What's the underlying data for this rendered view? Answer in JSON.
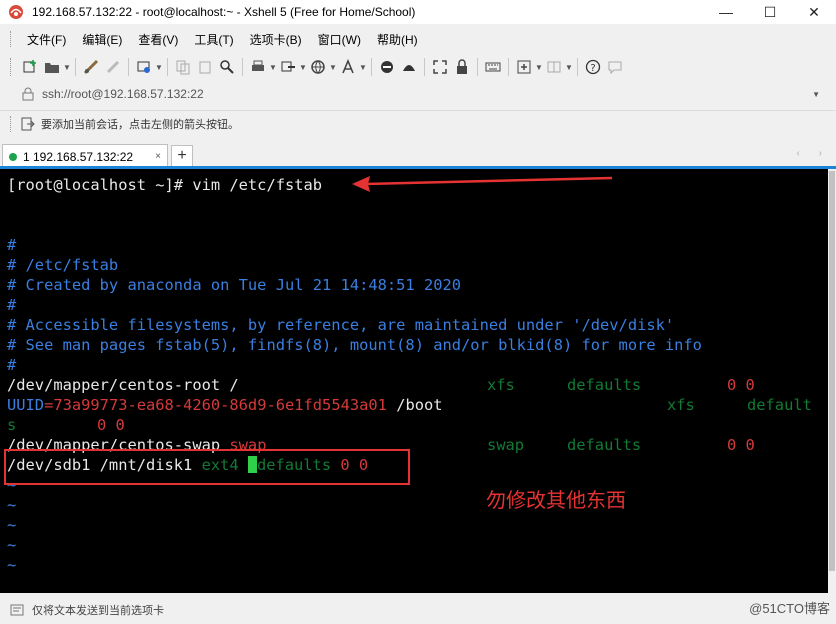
{
  "window": {
    "title": "192.168.57.132:22 - root@localhost:~ - Xshell 5 (Free for Home/School)",
    "controls": {
      "minimize": "—",
      "maximize": "☐",
      "close": "✕"
    }
  },
  "menu": {
    "items": [
      "文件(F)",
      "编辑(E)",
      "查看(V)",
      "工具(T)",
      "选项卡(B)",
      "窗口(W)",
      "帮助(H)"
    ]
  },
  "address": {
    "url": "ssh://root@192.168.57.132:22"
  },
  "hint": {
    "text": "要添加当前会话，点击左侧的箭头按钮。"
  },
  "tabs": {
    "items": [
      {
        "label": "1 192.168.57.132:22",
        "close": "×",
        "status_color": "#1aa34a"
      }
    ],
    "new_tab": "+",
    "nav": "‹ ›"
  },
  "terminal": {
    "prompt": "[root@localhost ~]# vim /etc/fstab",
    "comment_hash": "#",
    "comment_path": "# /etc/fstab",
    "comment_created": "# Created by anaconda on Tue Jul 21 14:48:51 2020",
    "comment_access": "# Accessible filesystems, by reference, are maintained under '/dev/disk'",
    "comment_see": "# See man pages fstab(5), findfs(8), mount(8) and/or blkid(8) for more info",
    "root_dev": "/dev/mapper/centos-root /",
    "root_fs": "xfs",
    "root_opts": "defaults",
    "root_nums": "0 0",
    "uuid_key": "UUID",
    "uuid_value": "=73a99773-ea68-4260-86d9-6e1fd5543a01",
    "uuid_mount": " /boot",
    "uuid_fs": "xfs",
    "uuid_opts": "default",
    "wrap_s": "s",
    "wrap_nums": "0 0",
    "swap_dev": "/dev/mapper/centos-swap ",
    "swap_mount": "swap",
    "swap_fs": "swap",
    "swap_opts": "defaults",
    "swap_nums": "0 0",
    "sdb_dev": "/dev/sdb1 /mnt/disk1 ",
    "sdb_fs": "ext4",
    "sdb_opts": "defaults",
    "sdb_nums": "0 0",
    "tilde": "~"
  },
  "annotation": {
    "text": "勿修改其他东西",
    "color": "#e53232"
  },
  "status": {
    "text": "仅将文本发送到当前选项卡"
  },
  "watermark": "@51CTO博客"
}
